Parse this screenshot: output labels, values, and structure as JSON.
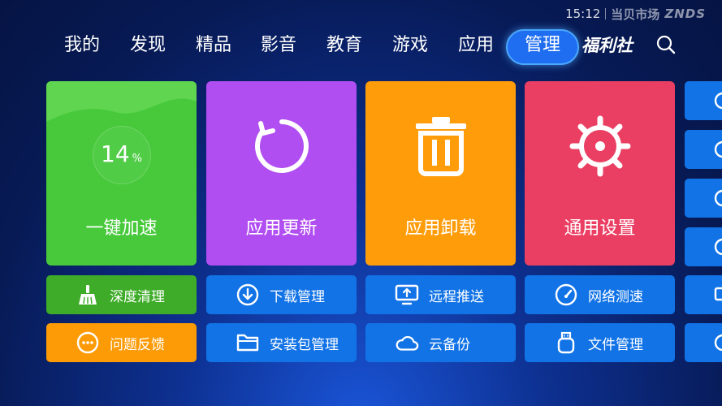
{
  "status": {
    "time": "15:12",
    "brand": "当贝市场",
    "brand_en": "ZNDS"
  },
  "nav": {
    "items": [
      "我的",
      "发现",
      "精品",
      "影音",
      "教育",
      "游戏",
      "应用",
      "管理"
    ],
    "active_index": 7,
    "logo_text": "福利社",
    "search_icon": "search-icon"
  },
  "tiles": [
    {
      "label": "一键加速",
      "percent": "14",
      "percent_unit": "%",
      "color": "#47c93b",
      "icon": "boost-ring-icon"
    },
    {
      "label": "应用更新",
      "color": "#b14ef1",
      "icon": "refresh-icon"
    },
    {
      "label": "应用卸载",
      "color": "#ff9c0a",
      "icon": "trash-icon"
    },
    {
      "label": "通用设置",
      "color": "#ea3f63",
      "icon": "gear-icon"
    }
  ],
  "buttons": {
    "row1": [
      {
        "label": "深度清理",
        "icon": "broom-icon",
        "color": "#3eac28"
      },
      {
        "label": "下载管理",
        "icon": "download-icon",
        "color": "#1273e6"
      },
      {
        "label": "远程推送",
        "icon": "remote-push-icon",
        "color": "#1273e6"
      },
      {
        "label": "网络测速",
        "icon": "speedometer-icon",
        "color": "#1273e6"
      }
    ],
    "row2": [
      {
        "label": "问题反馈",
        "icon": "feedback-icon",
        "color": "#fd9b06"
      },
      {
        "label": "安装包管理",
        "icon": "folder-icon",
        "color": "#1273e6"
      },
      {
        "label": "云备份",
        "icon": "cloud-icon",
        "color": "#1273e6"
      },
      {
        "label": "文件管理",
        "icon": "usb-drive-icon",
        "color": "#1273e6"
      }
    ]
  },
  "side_column": {
    "color": "#1273e6"
  }
}
